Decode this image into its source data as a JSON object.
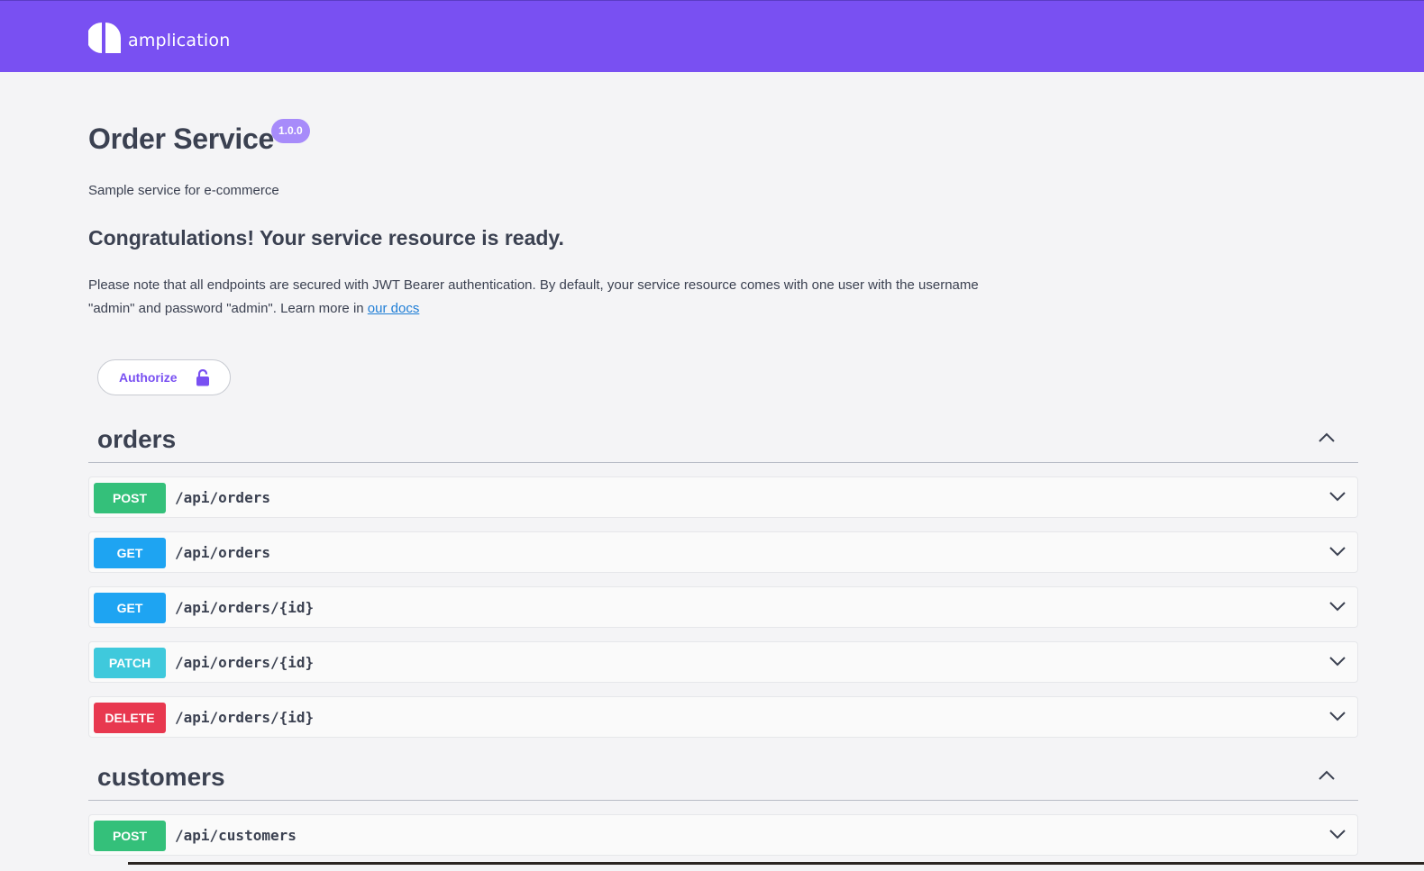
{
  "brand": {
    "name": "amplication"
  },
  "service": {
    "title": "Order Service",
    "version": "1.0.0",
    "description": "Sample service for e-commerce",
    "heading": "Congratulations! Your service resource is ready.",
    "note": "Please note that all endpoints are secured with JWT Bearer authentication. By default, your service resource comes with one user with the username \"admin\" and password \"admin\". Learn more in",
    "docs_link": "our docs"
  },
  "authorize": {
    "label": "Authorize"
  },
  "tags": [
    {
      "name": "orders",
      "operations": [
        {
          "method": "POST",
          "path": "/api/orders"
        },
        {
          "method": "GET",
          "path": "/api/orders"
        },
        {
          "method": "GET",
          "path": "/api/orders/{id}"
        },
        {
          "method": "PATCH",
          "path": "/api/orders/{id}"
        },
        {
          "method": "DELETE",
          "path": "/api/orders/{id}"
        }
      ]
    },
    {
      "name": "customers",
      "operations": [
        {
          "method": "POST",
          "path": "/api/customers"
        }
      ]
    }
  ],
  "colors": {
    "brand": "#7950f2",
    "post": "#34c07a",
    "get": "#1ea4f2",
    "patch": "#3fc9dc",
    "delete": "#e8384f"
  },
  "icons": {
    "logo": "amplication-logo-icon",
    "lock": "lock-icon",
    "collapse": "chevron-up-icon",
    "expand": "chevron-down-icon"
  }
}
